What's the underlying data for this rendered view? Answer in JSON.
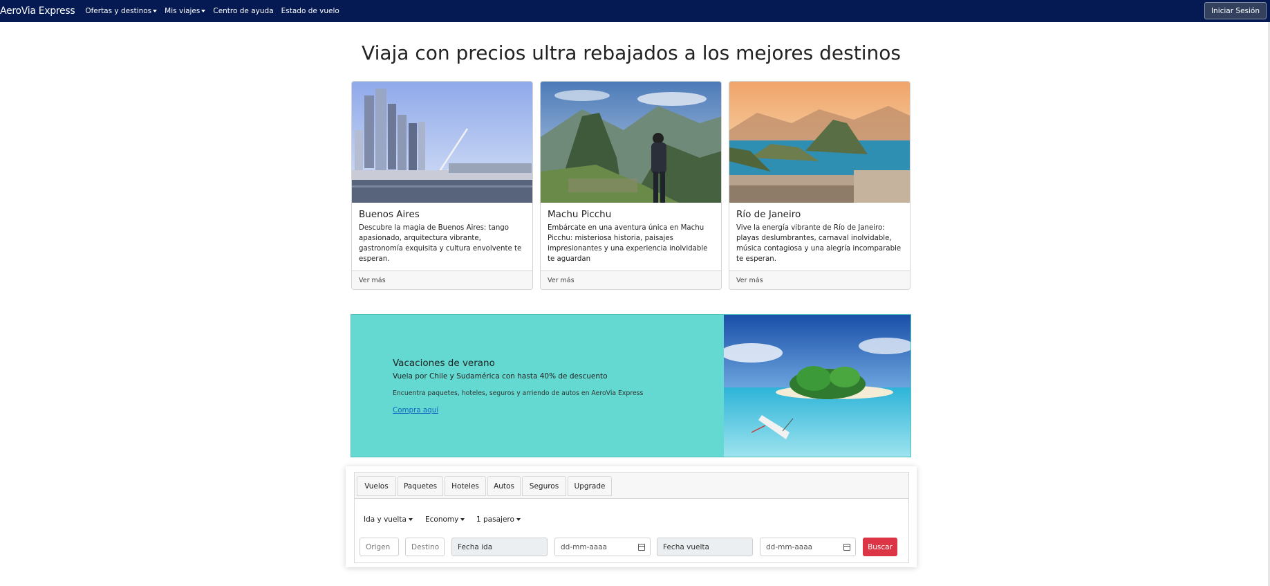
{
  "navbar": {
    "brand": "AeroVia Express",
    "items": [
      {
        "label": "Ofertas y destinos",
        "dropdown": true
      },
      {
        "label": "Mis viajes",
        "dropdown": true
      },
      {
        "label": "Centro de ayuda",
        "dropdown": false
      },
      {
        "label": "Estado de vuelo",
        "dropdown": false
      }
    ],
    "login_label": "Iniciar Sesión"
  },
  "hero": {
    "title": "Viaja con precios ultra rebajados a los mejores destinos"
  },
  "cards": [
    {
      "title": "Buenos Aires",
      "text": "Descubre la magia de Buenos Aires: tango apasionado, arquitectura vibrante, gastronomía exquisita y cultura envolvente te esperan.",
      "footer": "Ver más"
    },
    {
      "title": "Machu Picchu",
      "text": "Embárcate en una aventura única en Machu Picchu: misteriosa historia, paisajes impresionantes y una experiencia inolvidable te aguardan",
      "footer": "Ver más"
    },
    {
      "title": "Río de Janeiro",
      "text": "Vive la energía vibrante de Río de Janeiro: playas deslumbrantes, carnaval inolvidable, música contagiosa y una alegría incomparable te esperan.",
      "footer": "Ver más"
    }
  ],
  "promo": {
    "title": "Vacaciones de verano",
    "subtitle": "Vuela por Chile y Sudamérica con hasta 40% de descuento",
    "note": "Encuentra paquetes, hoteles, seguros y arriendo de autos en AeroVia Express",
    "link": "Compra aquí",
    "bg_color": "#63d9d1"
  },
  "search": {
    "tabs": [
      "Vuelos",
      "Paquetes",
      "Hoteles",
      "Autos",
      "Seguros",
      "Upgrade"
    ],
    "trip_type": "Ida y vuelta",
    "cabin": "Economy",
    "passengers": "1 pasajero",
    "origin_placeholder": "Origen",
    "destination_placeholder": "Destino",
    "departure_label": "Fecha ida",
    "departure_date": "dd-mm-aaaa",
    "return_label": "Fecha vuelta",
    "return_date": "dd-mm-aaaa",
    "submit_label": "Buscar",
    "submit_color": "#dc3545"
  },
  "colors": {
    "navbar": "#051a52"
  }
}
